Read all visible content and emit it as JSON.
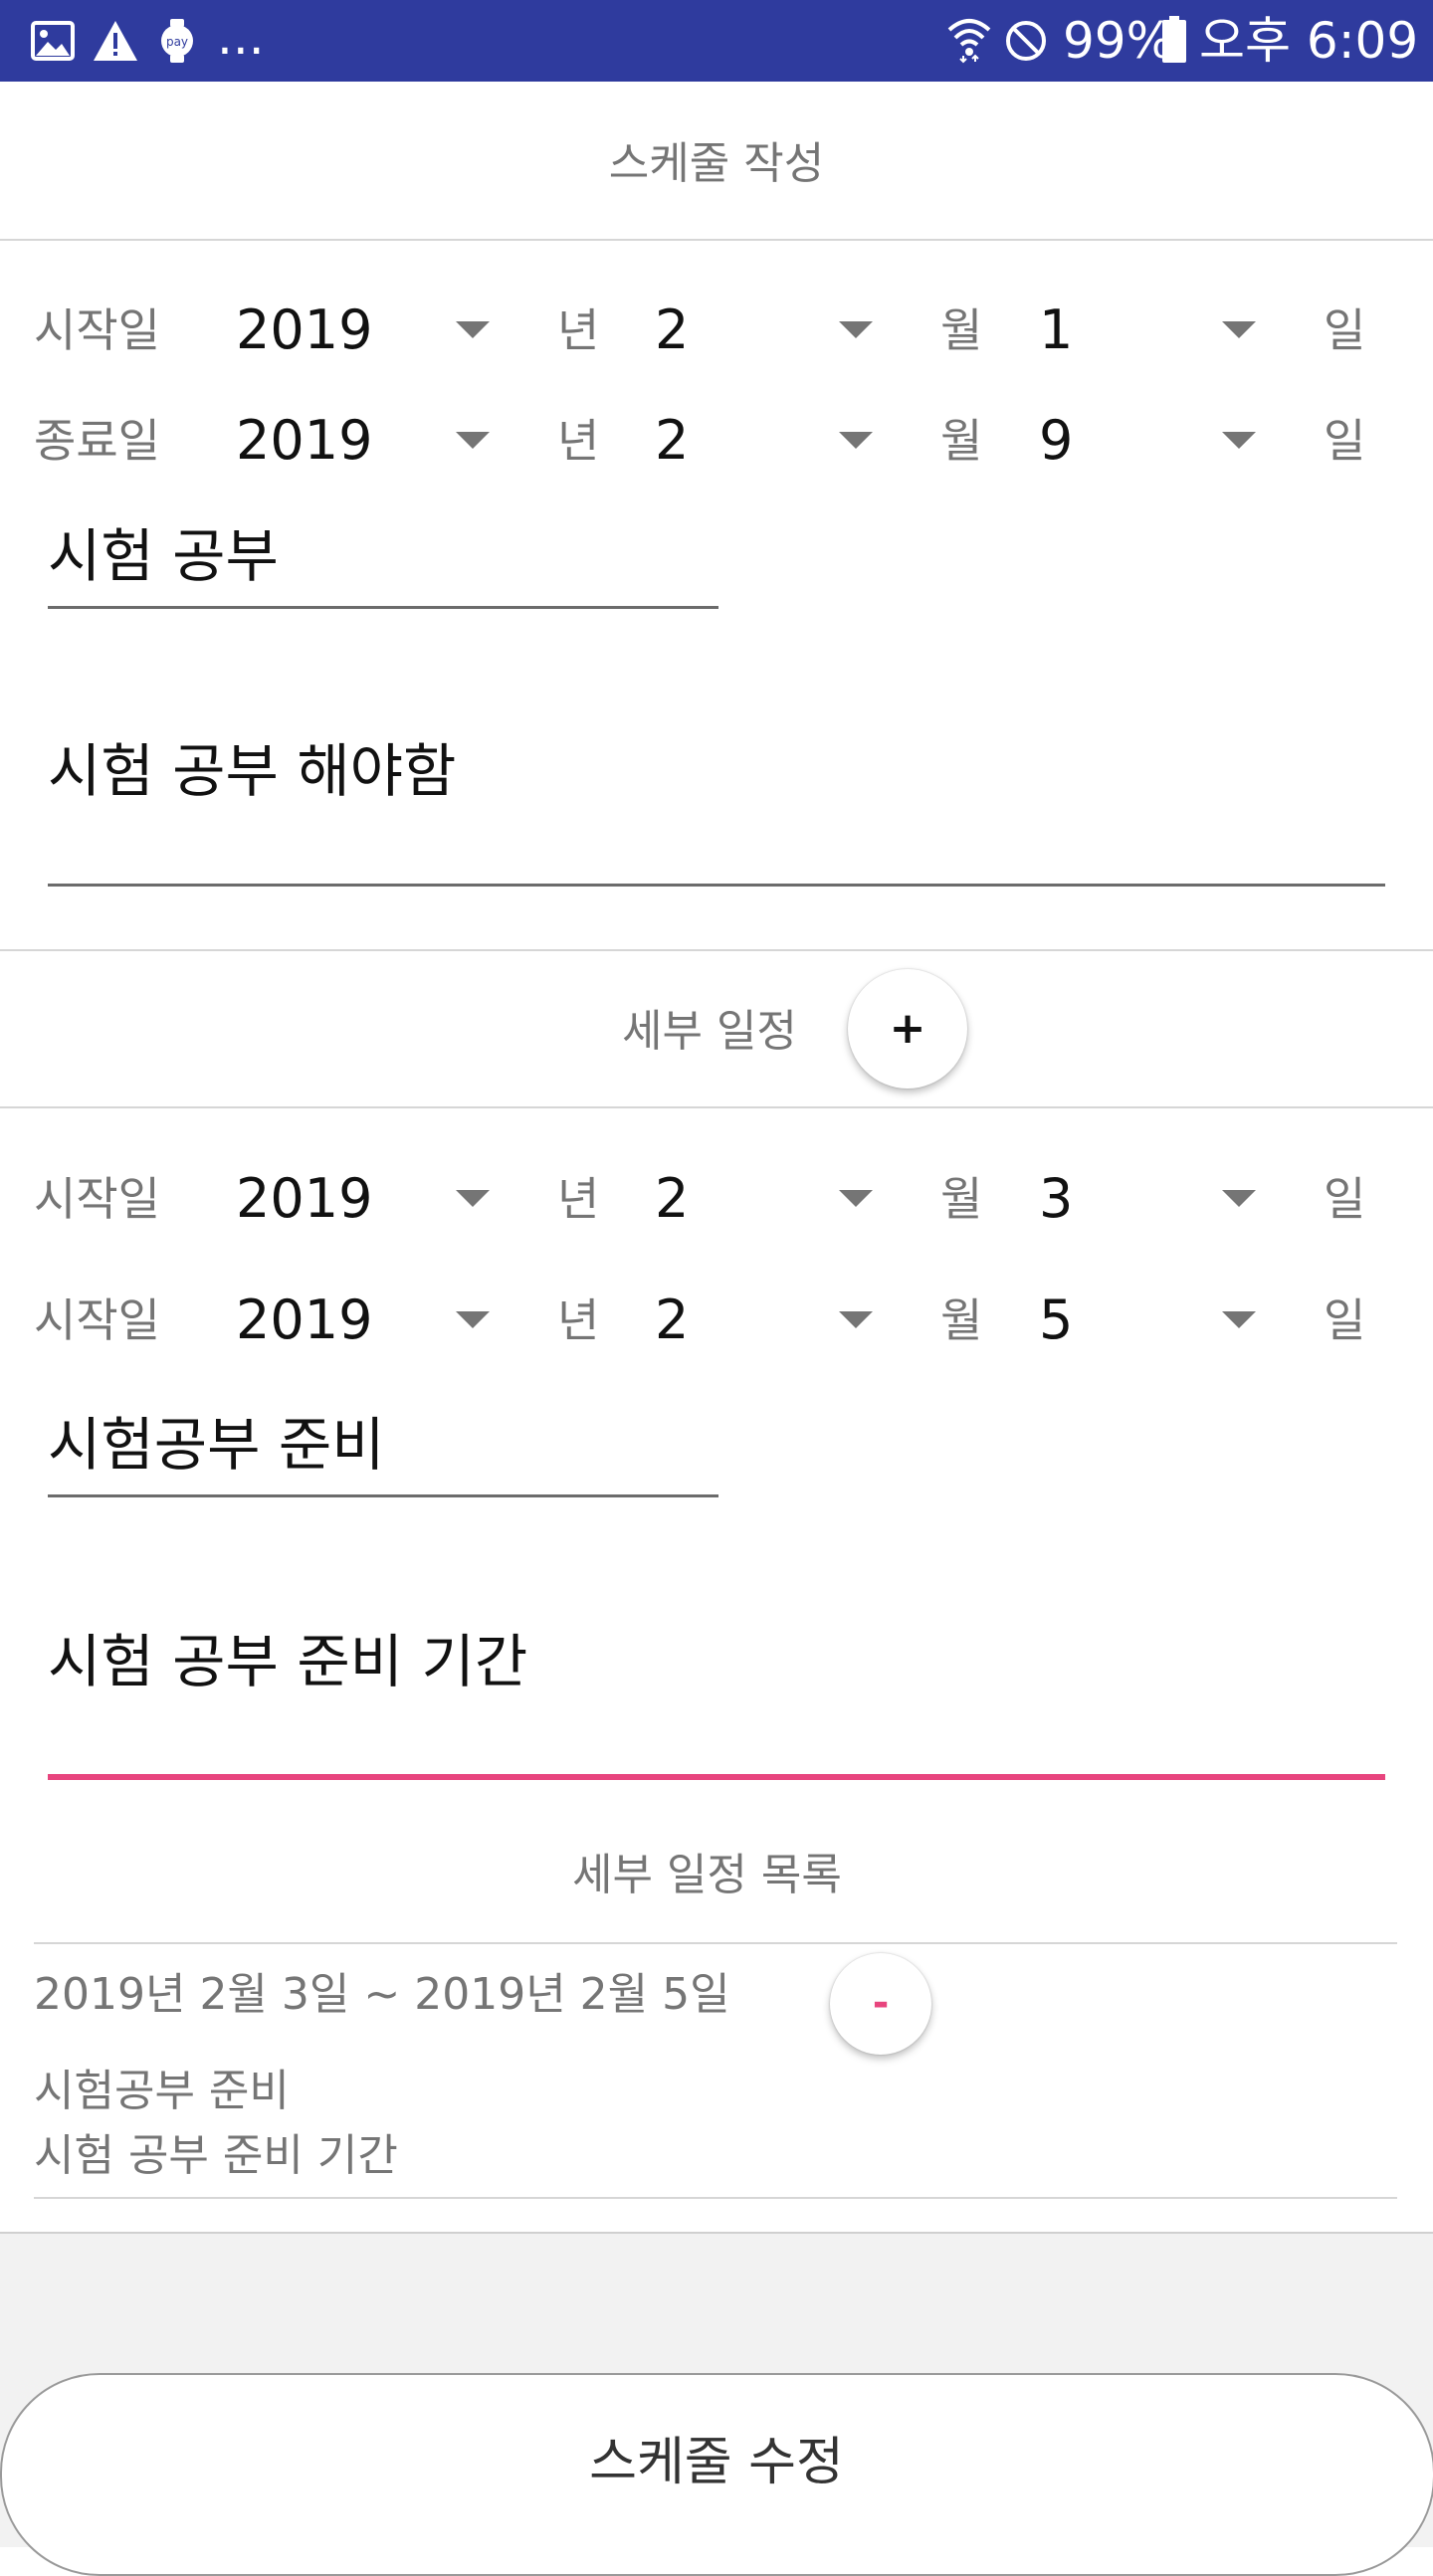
{
  "status_bar": {
    "battery": "99%",
    "time": "오후 6:09",
    "more": "..."
  },
  "header": {
    "title": "스케줄 작성"
  },
  "schedule": {
    "start": {
      "label": "시작일",
      "year": "2019",
      "month": "2",
      "day": "1"
    },
    "end": {
      "label": "종료일",
      "year": "2019",
      "month": "2",
      "day": "9"
    },
    "units": {
      "year": "년",
      "month": "월",
      "day": "일"
    },
    "title_value": "시험 공부",
    "description_value": "시험 공부 해야함"
  },
  "detail": {
    "section_label": "세부 일정",
    "add_button": "+",
    "start": {
      "label": "시작일",
      "year": "2019",
      "month": "2",
      "day": "3"
    },
    "end": {
      "label": "시작일",
      "year": "2019",
      "month": "2",
      "day": "5"
    },
    "title_value": "시험공부 준비",
    "description_value": "시험 공부 준비 기간"
  },
  "detail_list": {
    "title": "세부 일정 목록",
    "items": [
      {
        "range": "2019년 2월 3일 ~ 2019년 2월 5일",
        "title": "시험공부 준비",
        "description": "시험 공부 준비 기간",
        "remove_button": "-"
      }
    ]
  },
  "footer": {
    "submit_label": "스케줄 수정"
  },
  "colors": {
    "status_bar": "#2f3b9e",
    "accent": "#e8457e",
    "secondary_text": "#757575"
  }
}
